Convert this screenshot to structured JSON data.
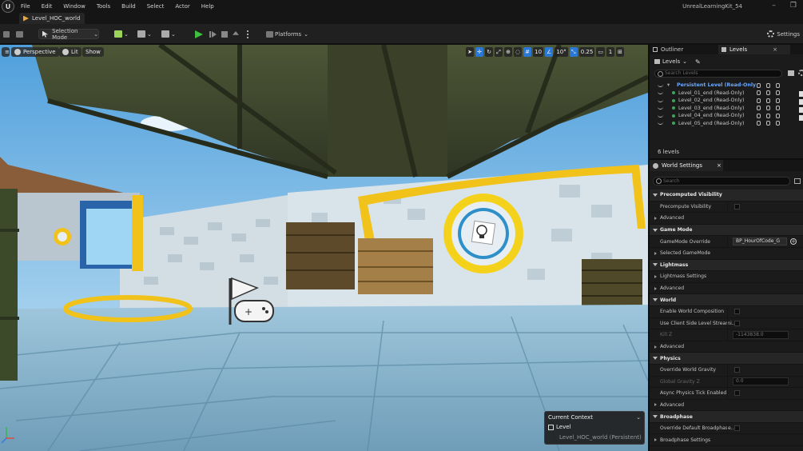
{
  "menubar": {
    "logo": "U",
    "items": [
      "File",
      "Edit",
      "Window",
      "Tools",
      "Build",
      "Select",
      "Actor",
      "Help"
    ],
    "project_name": "UnrealLearningKit_54",
    "minimize": "–",
    "restore": "❐"
  },
  "tab": {
    "label": "Level_HOC_world"
  },
  "toolbar": {
    "selection_mode": "Selection Mode",
    "platforms": "Platforms",
    "settings": "Settings"
  },
  "viewport": {
    "perspective": "Perspective",
    "lit": "Lit",
    "show": "Show",
    "grid_size": "10",
    "rot_snap": "10°",
    "scale_snap": "0.25",
    "cam_speed": "1",
    "context": {
      "title": "Current Context",
      "level_label": "Level",
      "world": "Level_HOC_world (Persistent)"
    }
  },
  "outliner": {
    "tabs": [
      "Outliner",
      "Levels"
    ],
    "close": "×",
    "levels_dropdown": "Levels",
    "search_placeholder": "Search Levels",
    "rows": [
      "Persistent Level (Read-Only",
      "Level_01_end (Read-Only)",
      "Level_02_end (Read-Only)",
      "Level_03_end (Read-Only)",
      "Level_04_end (Read-Only)",
      "Level_05_end (Read-Only)"
    ],
    "count": "6 levels"
  },
  "world_settings": {
    "title": "World Settings",
    "close": "×",
    "search_placeholder": "Search",
    "rows": [
      {
        "kind": "cat",
        "label": "Precomputed Visibility"
      },
      {
        "kind": "prop",
        "label": "Precompute Visibility",
        "control": "checkbox"
      },
      {
        "kind": "sub",
        "label": "Advanced"
      },
      {
        "kind": "cat",
        "label": "Game Mode"
      },
      {
        "kind": "prop",
        "label": "GameMode Override",
        "control": "select",
        "value": "BP_HourOfCode_G"
      },
      {
        "kind": "sub",
        "label": "Selected GameMode"
      },
      {
        "kind": "cat",
        "label": "Lightmass"
      },
      {
        "kind": "sub",
        "label": "Lightmass Settings"
      },
      {
        "kind": "sub",
        "label": "Advanced"
      },
      {
        "kind": "cat",
        "label": "World"
      },
      {
        "kind": "prop",
        "label": "Enable World Composition",
        "control": "checkbox"
      },
      {
        "kind": "prop",
        "label": "Use Client Side Level Streami...",
        "control": "checkbox"
      },
      {
        "kind": "prop",
        "label": "Kill Z",
        "control": "value",
        "value": "-1143838.0",
        "disabled": true
      },
      {
        "kind": "sub",
        "label": "Advanced"
      },
      {
        "kind": "cat",
        "label": "Physics"
      },
      {
        "kind": "prop",
        "label": "Override World Gravity",
        "control": "checkbox"
      },
      {
        "kind": "prop",
        "label": "Global Gravity Z",
        "control": "value",
        "value": "0.0",
        "disabled": true
      },
      {
        "kind": "prop",
        "label": "Async Physics Tick Enabled",
        "control": "checkbox"
      },
      {
        "kind": "sub",
        "label": "Advanced"
      },
      {
        "kind": "cat",
        "label": "Broadphase"
      },
      {
        "kind": "prop",
        "label": "Override Default Broadphase...",
        "control": "checkbox"
      },
      {
        "kind": "sub",
        "label": "Broadphase Settings"
      }
    ]
  }
}
